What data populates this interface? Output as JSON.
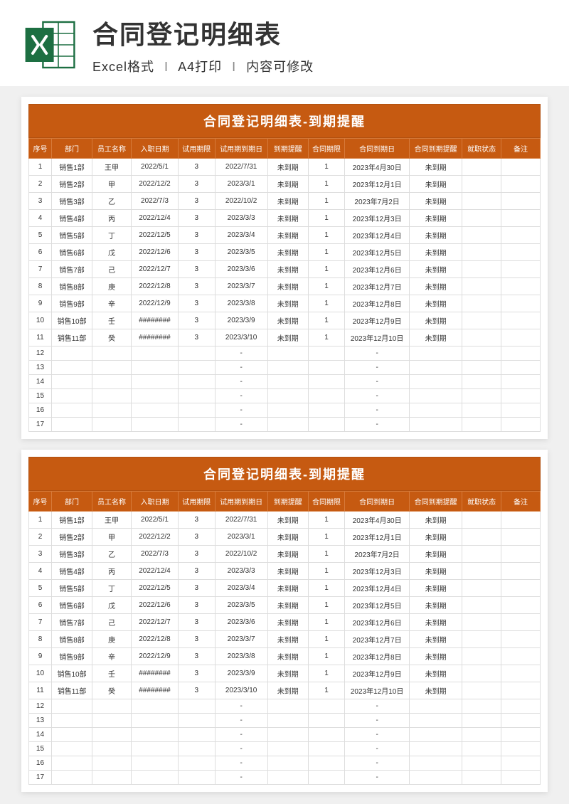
{
  "header": {
    "main_title": "合同登记明细表",
    "sub_format": "Excel格式",
    "sub_print": "A4打印",
    "sub_edit": "内容可修改"
  },
  "sheet": {
    "title": "合同登记明细表-到期提醒",
    "columns": [
      "序号",
      "部门",
      "员工名称",
      "入职日期",
      "试用期限",
      "试用期到期日",
      "到期提醒",
      "合同期限",
      "合同到期日",
      "合同到期提醒",
      "就职状态",
      "备注"
    ],
    "rows": [
      {
        "seq": "1",
        "dept": "销售1部",
        "name": "王甲",
        "hire": "2022/5/1",
        "trial_limit": "3",
        "trial_end": "2022/7/31",
        "trial_remind": "未到期",
        "contract_limit": "1",
        "contract_end": "2023年4月30日",
        "contract_remind": "未到期",
        "status": "",
        "note": ""
      },
      {
        "seq": "2",
        "dept": "销售2部",
        "name": "甲",
        "hire": "2022/12/2",
        "trial_limit": "3",
        "trial_end": "2023/3/1",
        "trial_remind": "未到期",
        "contract_limit": "1",
        "contract_end": "2023年12月1日",
        "contract_remind": "未到期",
        "status": "",
        "note": ""
      },
      {
        "seq": "3",
        "dept": "销售3部",
        "name": "乙",
        "hire": "2022/7/3",
        "trial_limit": "3",
        "trial_end": "2022/10/2",
        "trial_remind": "未到期",
        "contract_limit": "1",
        "contract_end": "2023年7月2日",
        "contract_remind": "未到期",
        "status": "",
        "note": ""
      },
      {
        "seq": "4",
        "dept": "销售4部",
        "name": "丙",
        "hire": "2022/12/4",
        "trial_limit": "3",
        "trial_end": "2023/3/3",
        "trial_remind": "未到期",
        "contract_limit": "1",
        "contract_end": "2023年12月3日",
        "contract_remind": "未到期",
        "status": "",
        "note": ""
      },
      {
        "seq": "5",
        "dept": "销售5部",
        "name": "丁",
        "hire": "2022/12/5",
        "trial_limit": "3",
        "trial_end": "2023/3/4",
        "trial_remind": "未到期",
        "contract_limit": "1",
        "contract_end": "2023年12月4日",
        "contract_remind": "未到期",
        "status": "",
        "note": ""
      },
      {
        "seq": "6",
        "dept": "销售6部",
        "name": "戊",
        "hire": "2022/12/6",
        "trial_limit": "3",
        "trial_end": "2023/3/5",
        "trial_remind": "未到期",
        "contract_limit": "1",
        "contract_end": "2023年12月5日",
        "contract_remind": "未到期",
        "status": "",
        "note": ""
      },
      {
        "seq": "7",
        "dept": "销售7部",
        "name": "己",
        "hire": "2022/12/7",
        "trial_limit": "3",
        "trial_end": "2023/3/6",
        "trial_remind": "未到期",
        "contract_limit": "1",
        "contract_end": "2023年12月6日",
        "contract_remind": "未到期",
        "status": "",
        "note": ""
      },
      {
        "seq": "8",
        "dept": "销售8部",
        "name": "庚",
        "hire": "2022/12/8",
        "trial_limit": "3",
        "trial_end": "2023/3/7",
        "trial_remind": "未到期",
        "contract_limit": "1",
        "contract_end": "2023年12月7日",
        "contract_remind": "未到期",
        "status": "",
        "note": ""
      },
      {
        "seq": "9",
        "dept": "销售9部",
        "name": "辛",
        "hire": "2022/12/9",
        "trial_limit": "3",
        "trial_end": "2023/3/8",
        "trial_remind": "未到期",
        "contract_limit": "1",
        "contract_end": "2023年12月8日",
        "contract_remind": "未到期",
        "status": "",
        "note": ""
      },
      {
        "seq": "10",
        "dept": "销售10部",
        "name": "壬",
        "hire": "########",
        "trial_limit": "3",
        "trial_end": "2023/3/9",
        "trial_remind": "未到期",
        "contract_limit": "1",
        "contract_end": "2023年12月9日",
        "contract_remind": "未到期",
        "status": "",
        "note": ""
      },
      {
        "seq": "11",
        "dept": "销售11部",
        "name": "癸",
        "hire": "########",
        "trial_limit": "3",
        "trial_end": "2023/3/10",
        "trial_remind": "未到期",
        "contract_limit": "1",
        "contract_end": "2023年12月10日",
        "contract_remind": "未到期",
        "status": "",
        "note": ""
      },
      {
        "seq": "12",
        "dept": "",
        "name": "",
        "hire": "",
        "trial_limit": "",
        "trial_end": "-",
        "trial_remind": "",
        "contract_limit": "",
        "contract_end": "-",
        "contract_remind": "",
        "status": "",
        "note": ""
      },
      {
        "seq": "13",
        "dept": "",
        "name": "",
        "hire": "",
        "trial_limit": "",
        "trial_end": "-",
        "trial_remind": "",
        "contract_limit": "",
        "contract_end": "-",
        "contract_remind": "",
        "status": "",
        "note": ""
      },
      {
        "seq": "14",
        "dept": "",
        "name": "",
        "hire": "",
        "trial_limit": "",
        "trial_end": "-",
        "trial_remind": "",
        "contract_limit": "",
        "contract_end": "-",
        "contract_remind": "",
        "status": "",
        "note": ""
      },
      {
        "seq": "15",
        "dept": "",
        "name": "",
        "hire": "",
        "trial_limit": "",
        "trial_end": "-",
        "trial_remind": "",
        "contract_limit": "",
        "contract_end": "-",
        "contract_remind": "",
        "status": "",
        "note": ""
      },
      {
        "seq": "16",
        "dept": "",
        "name": "",
        "hire": "",
        "trial_limit": "",
        "trial_end": "-",
        "trial_remind": "",
        "contract_limit": "",
        "contract_end": "-",
        "contract_remind": "",
        "status": "",
        "note": ""
      },
      {
        "seq": "17",
        "dept": "",
        "name": "",
        "hire": "",
        "trial_limit": "",
        "trial_end": "-",
        "trial_remind": "",
        "contract_limit": "",
        "contract_end": "-",
        "contract_remind": "",
        "status": "",
        "note": ""
      }
    ]
  }
}
